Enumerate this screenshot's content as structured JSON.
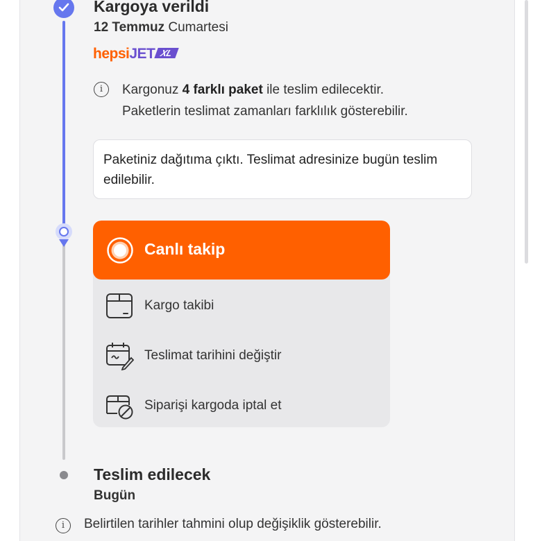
{
  "shipment": {
    "title": "Kargoya verildi",
    "date_bold": "12 Temmuz",
    "date_rest": "Cumartesi",
    "brand": {
      "part1": "hepsi",
      "part2": "JET",
      "badge": "XL"
    },
    "info_prefix": "Kargonuz ",
    "info_bold": "4 farklı paket",
    "info_suffix": " ile teslim edilecektir.",
    "info_line2": "Paketlerin teslimat zamanları farklılık gösterebilir.",
    "notice": "Paketiniz dağıtıma çıktı. Teslimat adresinize bugün teslim edilebilir."
  },
  "actions": {
    "live": "Canlı takip",
    "items": [
      {
        "label": "Kargo takibi",
        "icon": "box-icon"
      },
      {
        "label": "Teslimat tarihini değiştir",
        "icon": "calendar-edit-icon"
      },
      {
        "label": "Siparişi kargoda iptal et",
        "icon": "box-cancel-icon"
      }
    ]
  },
  "delivery": {
    "title": "Teslim edilecek",
    "date": "Bugün"
  },
  "footer_note": "Belirtilen tarihler tahmini olup değişiklik gösterebilir.",
  "colors": {
    "accent_orange": "#ff6000",
    "timeline_blue": "#6677ee",
    "brand_purple": "#6a4fcf"
  }
}
